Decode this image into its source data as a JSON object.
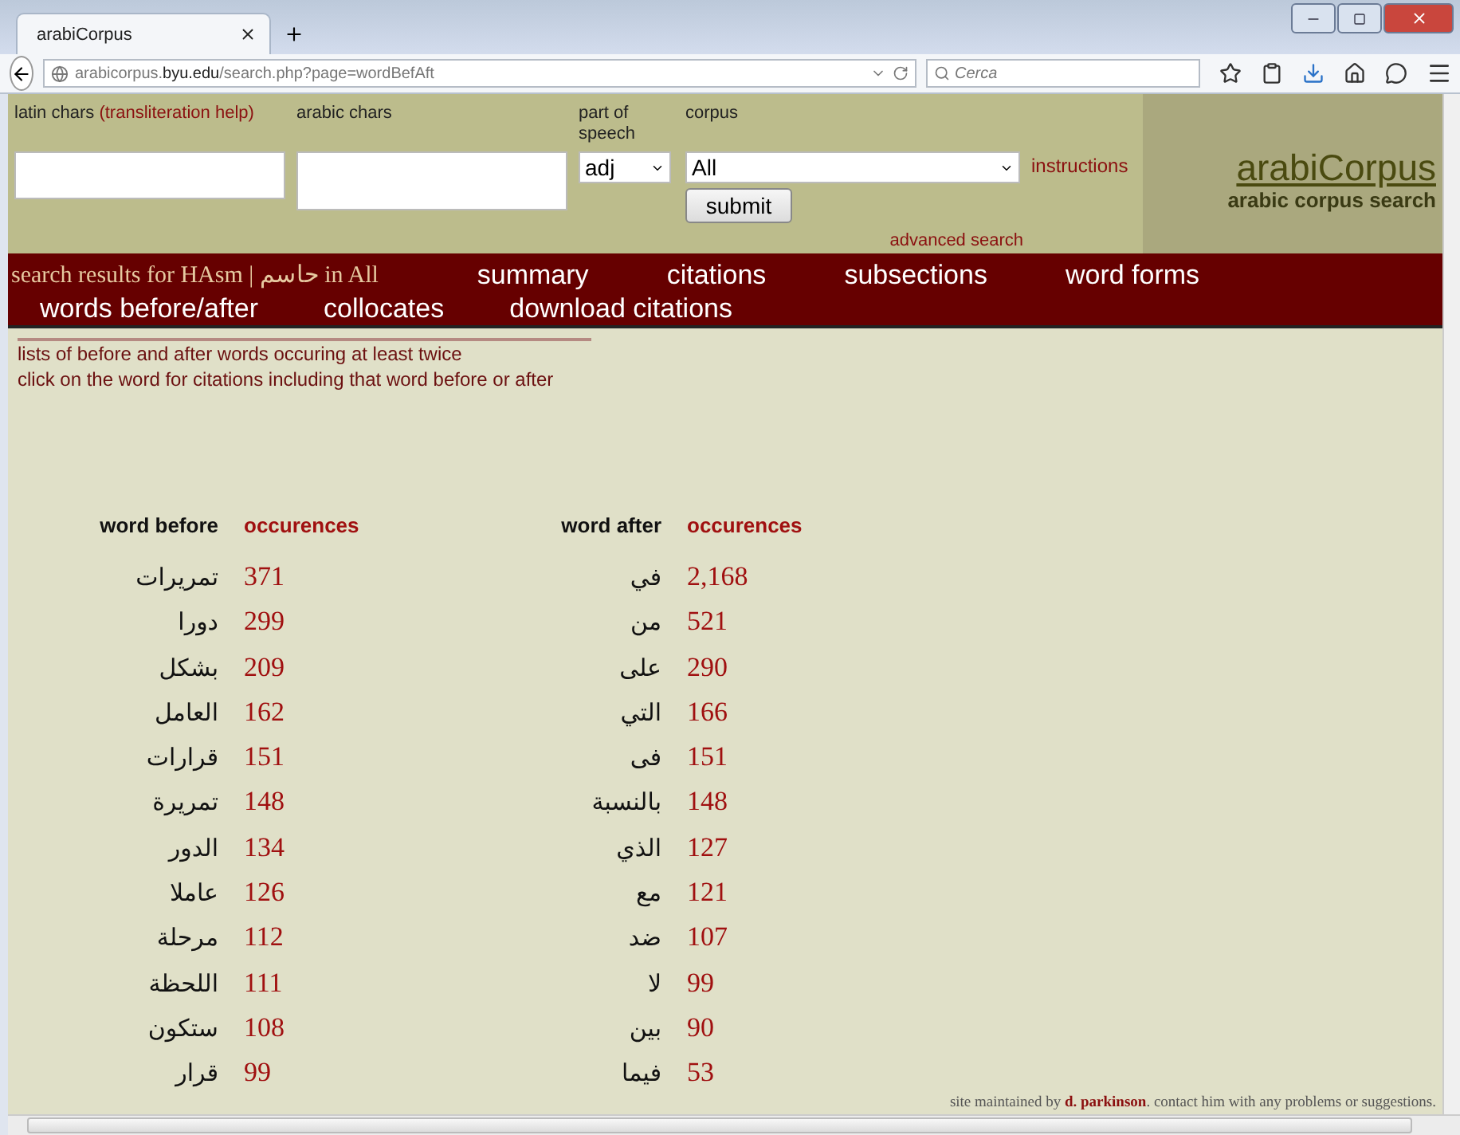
{
  "browser": {
    "tab_title": "arabiCorpus",
    "url": "arabicorpus.**byu.edu**/search.php?page=wordBefAft",
    "search_placeholder": "Cerca"
  },
  "search_form": {
    "latin_label": "latin chars",
    "transliteration_link": "(transliteration help)",
    "arabic_label": "arabic chars",
    "pos_label": "part of speech",
    "pos_value": "adj",
    "corpus_label": "corpus",
    "corpus_value": "All",
    "submit": "submit",
    "instructions": "instructions",
    "advanced": "advanced search"
  },
  "logo": {
    "title": "arabiCorpus",
    "subtitle": "arabic corpus search"
  },
  "nav": {
    "results_caption": "search results for HAsm | حاسم in All",
    "links": [
      {
        "label": "summary"
      },
      {
        "label": "citations"
      },
      {
        "label": "subsections"
      },
      {
        "label": "word forms"
      },
      {
        "label": "words before/after"
      },
      {
        "label": "collocates"
      },
      {
        "label": "download citations"
      }
    ]
  },
  "intro": [
    "lists of before and after words occuring at least twice",
    "click on the word for citations including that word before or after"
  ],
  "before_table": {
    "columns": [
      "word before",
      "occurences"
    ],
    "rows": [
      [
        "تمريرات",
        "371"
      ],
      [
        "دورا",
        "299"
      ],
      [
        "بشكل",
        "209"
      ],
      [
        "العامل",
        "162"
      ],
      [
        "قرارات",
        "151"
      ],
      [
        "تمريرة",
        "148"
      ],
      [
        "الدور",
        "134"
      ],
      [
        "عاملا",
        "126"
      ],
      [
        "مرحلة",
        "112"
      ],
      [
        "اللحظة",
        "111"
      ],
      [
        "ستكون",
        "108"
      ],
      [
        "قرار",
        "99"
      ]
    ]
  },
  "after_table": {
    "columns": [
      "word after",
      "occurences"
    ],
    "rows": [
      [
        "في",
        "2,168"
      ],
      [
        "من",
        "521"
      ],
      [
        "على",
        "290"
      ],
      [
        "التي",
        "166"
      ],
      [
        "فى",
        "151"
      ],
      [
        "بالنسبة",
        "148"
      ],
      [
        "الذي",
        "127"
      ],
      [
        "مع",
        "121"
      ],
      [
        "ضد",
        "107"
      ],
      [
        "لا",
        "99"
      ],
      [
        "بين",
        "90"
      ],
      [
        "فيما",
        "53"
      ]
    ]
  },
  "footer": {
    "before": "site maintained by",
    "link": "d. parkinson",
    "after": ". contact him with any problems or suggestions."
  }
}
